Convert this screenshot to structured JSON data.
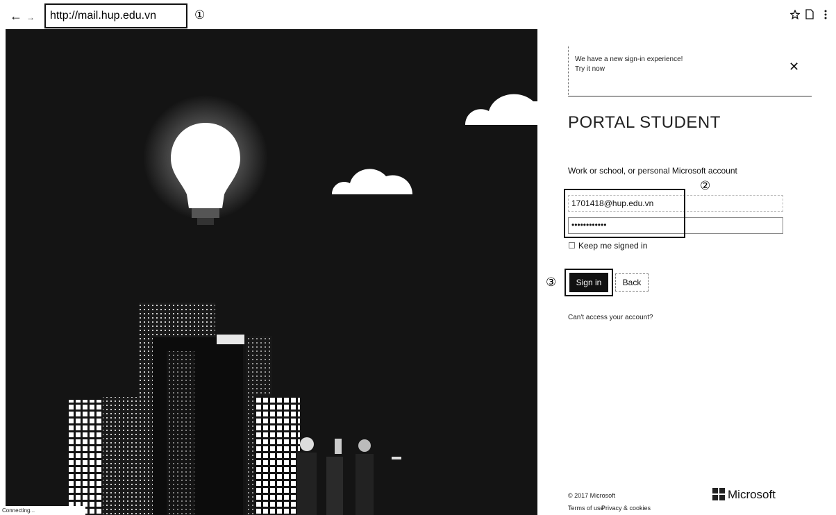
{
  "browser": {
    "back_icon": "←",
    "forward_icon": "→",
    "url": "http://mail.hup.edu.vn",
    "markers": {
      "one": "①",
      "two": "②",
      "three": "③"
    }
  },
  "banner": {
    "line1": "We have a new sign-in experience!",
    "line2": "Try it now",
    "close": "✕"
  },
  "signin": {
    "title": "PORTAL STUDENT",
    "account_label": "Work or school, or personal Microsoft account",
    "email_value": "1701418@hup.edu.vn",
    "password_value": "••••••••••••",
    "keep_signed_in": "Keep me signed in",
    "signin_button": "Sign in",
    "back_button": "Back",
    "cant_access": "Can't access your account?"
  },
  "footer": {
    "copyright": "© 2017 Microsoft",
    "terms": "Terms of use",
    "privacy": "Privacy & cookies",
    "brand": "Microsoft"
  },
  "status": {
    "text": "Connecting..."
  },
  "colors": {
    "hero_background": "#141414",
    "button": "#111111"
  }
}
